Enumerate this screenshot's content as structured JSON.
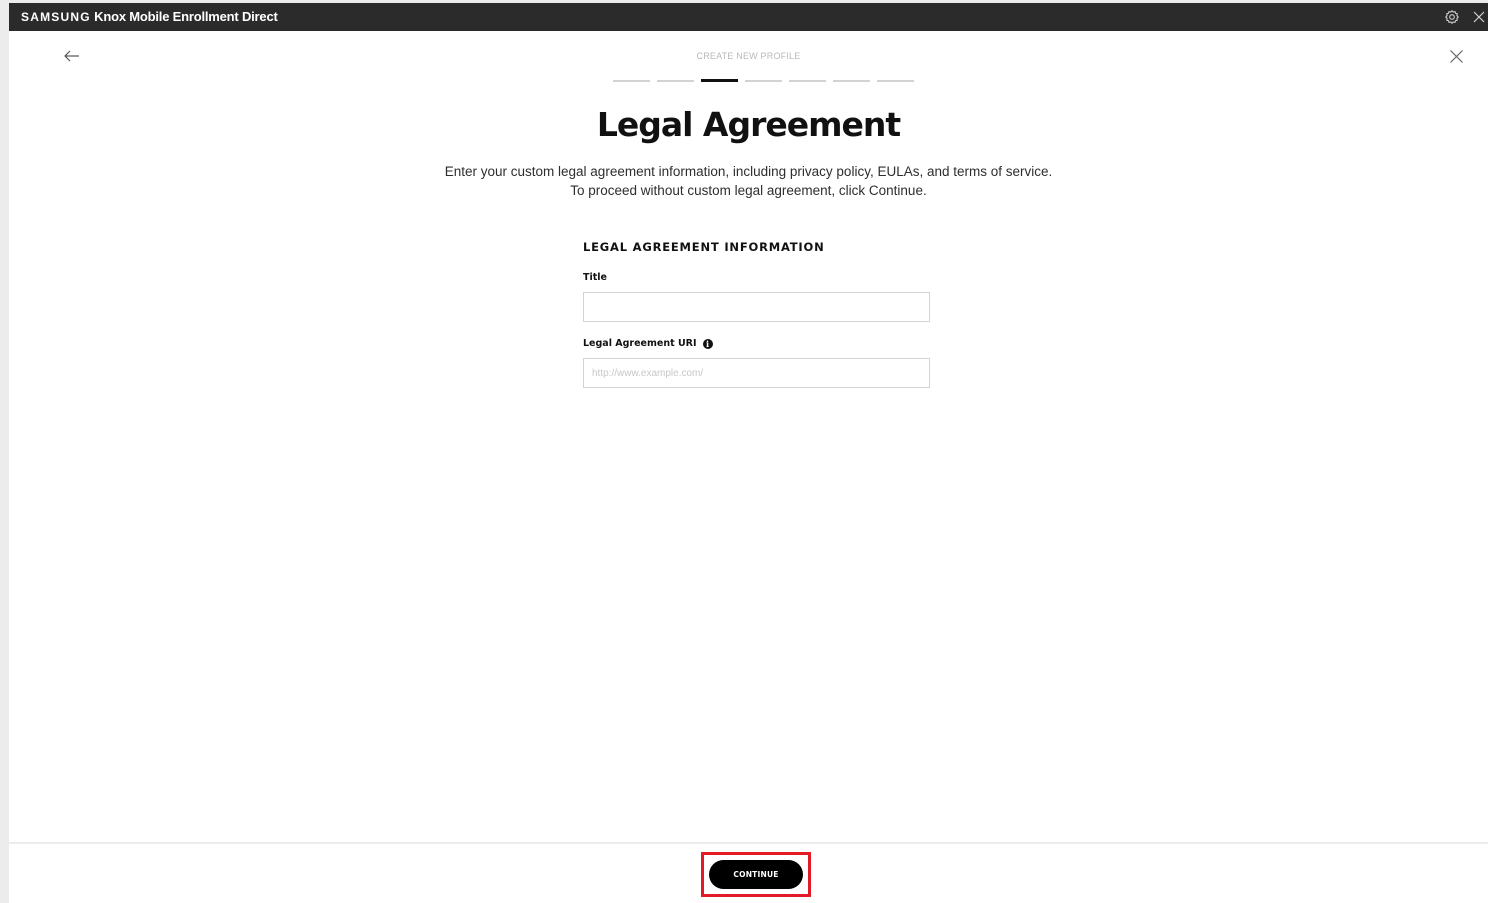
{
  "app": {
    "brand_samsung": "SAMSUNG",
    "brand_rest": " Knox Mobile Enrollment Direct",
    "settings_icon": "gear-icon",
    "close_icon": "close-icon"
  },
  "wizard": {
    "label": "CREATE NEW PROFILE",
    "total_steps": 7,
    "current_step": 3
  },
  "page": {
    "title": "Legal Agreement",
    "description_line1": "Enter your custom legal agreement information, including privacy policy, EULAs, and terms of service.",
    "description_line2": "To proceed without custom legal agreement, click Continue."
  },
  "form": {
    "section_title": "LEGAL AGREEMENT INFORMATION",
    "title_label": "Title",
    "title_value": "",
    "uri_label": "Legal Agreement URI",
    "uri_value": "",
    "uri_placeholder": "http://www.example.com/",
    "info_icon": "i"
  },
  "footer": {
    "continue_label": "CONTINUE"
  },
  "colors": {
    "titlebar": "#2b2b2b",
    "accent_highlight": "#e21b24",
    "primary_button": "#000000"
  }
}
